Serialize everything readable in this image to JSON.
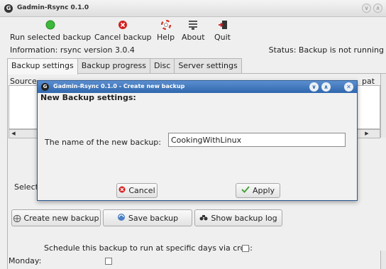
{
  "window": {
    "title": "Gadmin-Rsync 0.1.0"
  },
  "toolbar": {
    "run_label": "Run selected backup",
    "cancel_label": "Cancel backup",
    "help_label": "Help",
    "about_label": "About",
    "quit_label": "Quit"
  },
  "info": {
    "text": "Information: rsync  version 3.0.4",
    "status": "Status: Backup is not running"
  },
  "tabs": [
    {
      "label": "Backup settings"
    },
    {
      "label": "Backup progress"
    },
    {
      "label": "Disc"
    },
    {
      "label": "Server settings"
    }
  ],
  "list": {
    "source_label": "Source",
    "path_label": "pat"
  },
  "select_label": "Select",
  "buttons": {
    "create_label": "Create new backup",
    "save_label": "Save backup",
    "log_label": "Show backup log"
  },
  "schedule": {
    "label": "Schedule this backup to run at specific days via cron:",
    "monday_label": "Monday:"
  },
  "dialog": {
    "title": "Gadmin-Rsync 0.1.0 - Create new backup",
    "heading": "New Backup settings:",
    "name_label": "The name of the new backup:",
    "name_value": "CookingWithLinux",
    "cancel_label": "Cancel",
    "apply_label": "Apply"
  },
  "colors": {
    "run_icon": "#3db83a",
    "cancel_icon": "#d42020",
    "dialog_titlebar": "#3a74be"
  }
}
